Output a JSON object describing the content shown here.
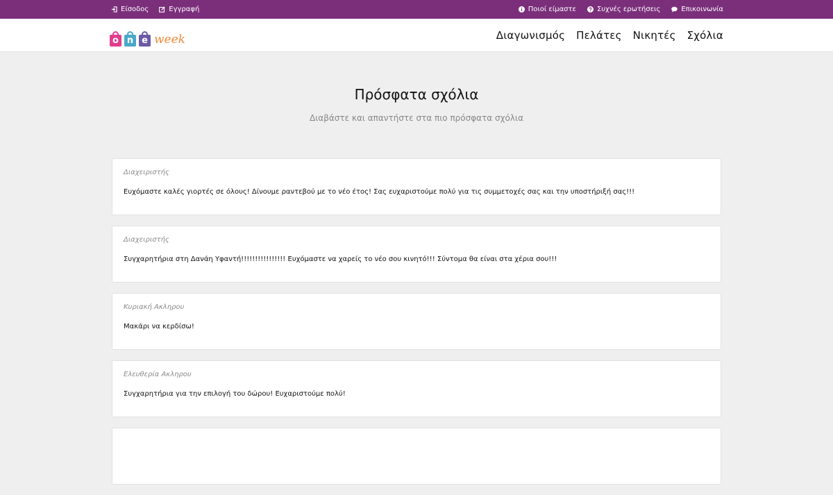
{
  "colors": {
    "topbar": "#7b2f7b",
    "page_bg": "#efefef",
    "logo_o": "#e13d8e",
    "logo_n": "#4aa7c7",
    "logo_e": "#6b5aa6",
    "logo_word": "#f08a3c"
  },
  "topbar": {
    "left": [
      {
        "icon": "sign-in-icon",
        "label": "Είσοδος"
      },
      {
        "icon": "edit-icon",
        "label": "Εγγραφή"
      }
    ],
    "right": [
      {
        "icon": "info-icon",
        "label": "Ποιοί είμαστε"
      },
      {
        "icon": "question-icon",
        "label": "Συχνές ερωτήσεις"
      },
      {
        "icon": "chat-icon",
        "label": "Επικοινωνία"
      }
    ]
  },
  "logo": {
    "letters": [
      "o",
      "n",
      "e"
    ],
    "word": "week"
  },
  "nav": [
    "Διαγωνισμός",
    "Πελάτες",
    "Νικητές",
    "Σχόλια"
  ],
  "page": {
    "title": "Πρόσφατα σχόλια",
    "subtitle": "Διαβάστε και απαντήστε στα πιο πρόσφατα σχόλια"
  },
  "comments": [
    {
      "author": "Διαχειριστής",
      "text": "Ευχόμαστε καλές γιορτές σε όλους! Δίνουμε ραντεβού με το νέο έτος! Σας ευχαριστούμε πολύ για τις συμμετοχές σας και την υποστήριξή σας!!!"
    },
    {
      "author": "Διαχειριστής",
      "text": "Συγχαρητήρια στη Δανάη Υφαντή!!!!!!!!!!!!!!!! Ευχόμαστε να χαρείς το νέο σου κινητό!!! Σύντομα θα είναι στα χέρια σου!!!"
    },
    {
      "author": "Κυριακή Ακληρου",
      "text": "Μακάρι να κερδίσω!"
    },
    {
      "author": "Ελευθερία Ακληρου",
      "text": "Συγχαρητήρια για την επιλογή του δώρου! Ευχαριστούμε πολύ!"
    },
    {
      "author": "",
      "text": ""
    }
  ]
}
